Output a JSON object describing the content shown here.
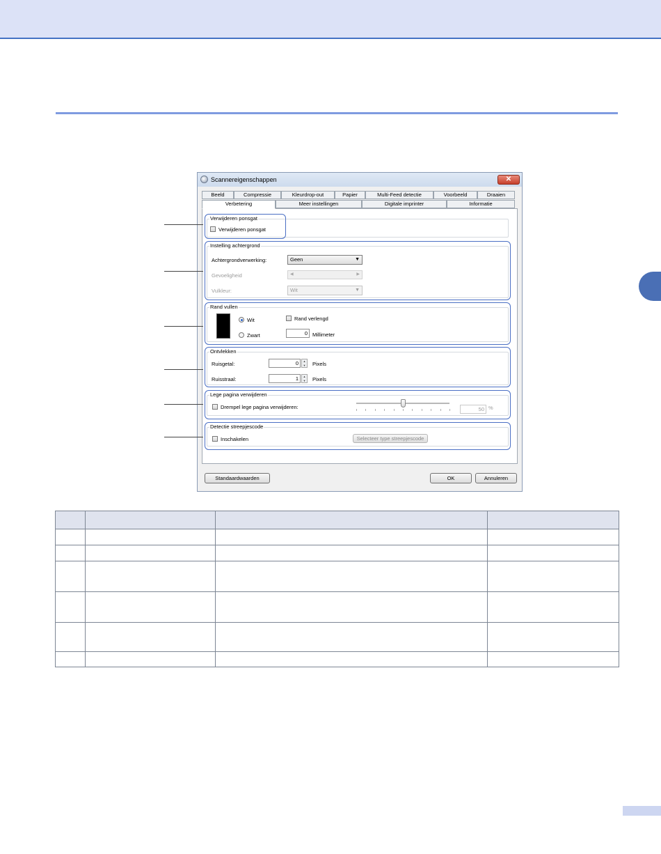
{
  "window": {
    "title": "Scannereigenschappen",
    "close_label": "✕",
    "tabs_row1": [
      "Beeld",
      "Compressie",
      "Kleurdrop-out",
      "Papier",
      "Multi-Feed detectie",
      "Voorbeeld",
      "Draaien"
    ],
    "tabs_row2": [
      "Verbetering",
      "Meer instellingen",
      "Digitale imprinter",
      "Informatie"
    ],
    "active_tab": "Verbetering"
  },
  "punch": {
    "group_label": "Verwijderen ponsgat",
    "checkbox_label": "Verwijderen ponsgat"
  },
  "background": {
    "group_label": "Instelling achtergrond",
    "processing_label": "Achtergrondverwerking:",
    "processing_value": "Geen",
    "sensitivity_label": "Gevoeligheid",
    "fill_color_label": "Vulkleur:",
    "fill_color_value": "Wit"
  },
  "edge": {
    "group_label": "Rand vullen",
    "white_label": "Wit",
    "black_label": "Zwart",
    "extended_label": "Rand verlengd",
    "value": "0",
    "unit": "Millimeter"
  },
  "despeckle": {
    "group_label": "Ontvlekken",
    "noise_count_label": "Ruisgetal:",
    "noise_count_value": "0",
    "noise_radius_label": "Ruisstraal:",
    "noise_radius_value": "1",
    "unit": "Pixels"
  },
  "blank_page": {
    "group_label": "Lege pagina verwijderen",
    "checkbox_label": "Drempel lege pagina verwijderen:",
    "threshold_value": "50",
    "threshold_unit": "%",
    "slider_fraction": 0.5
  },
  "barcode": {
    "group_label": "Detectie streepjescode",
    "enable_label": "Inschakelen",
    "select_button": "Selecteer type streepjescode"
  },
  "buttons": {
    "defaults": "Standaardwaarden",
    "ok": "OK",
    "cancel": "Annuleren"
  }
}
